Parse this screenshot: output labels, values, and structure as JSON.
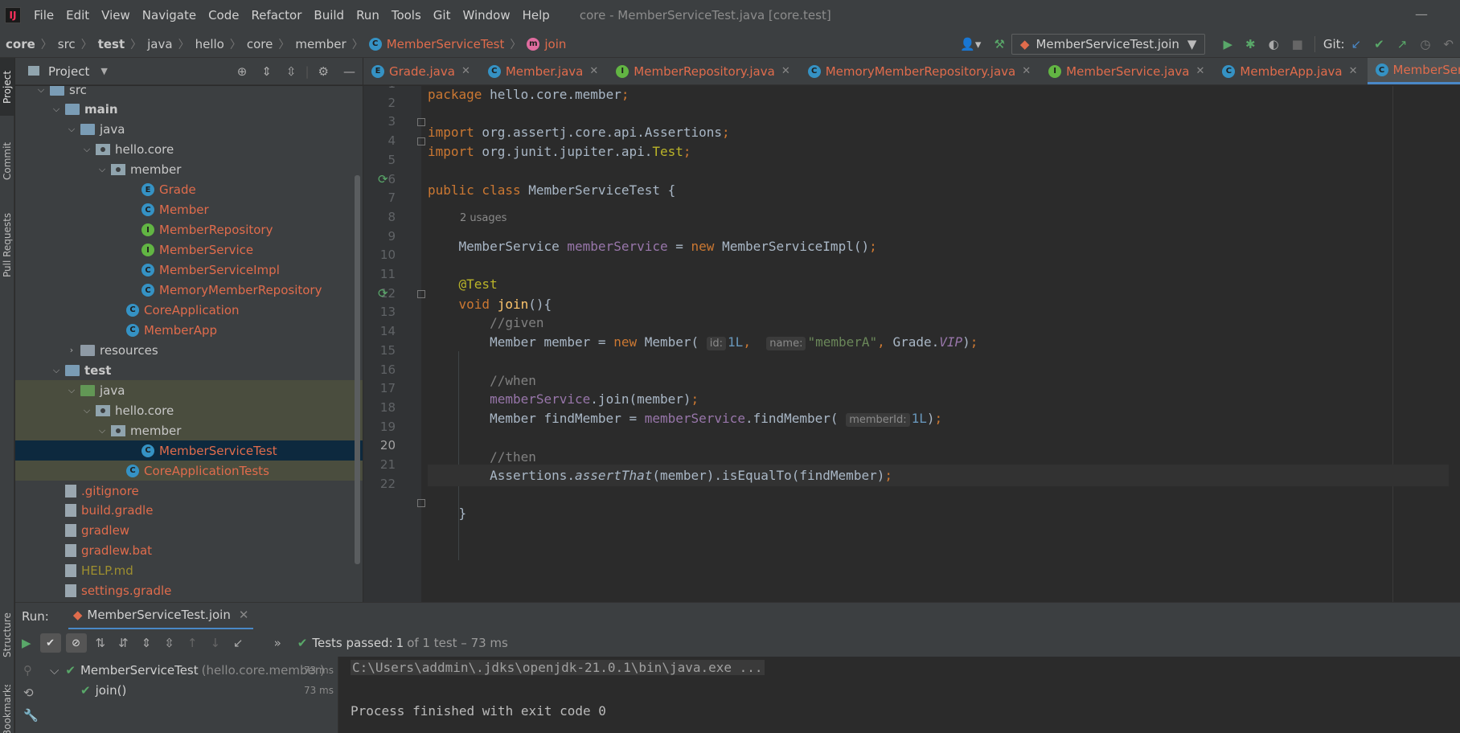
{
  "menubar": {
    "items": [
      "File",
      "Edit",
      "View",
      "Navigate",
      "Code",
      "Refactor",
      "Build",
      "Run",
      "Tools",
      "Git",
      "Window",
      "Help"
    ],
    "window_title": "core - MemberServiceTest.java [core.test]"
  },
  "breadcrumb": {
    "items": [
      "core",
      "src",
      "test",
      "java",
      "hello",
      "core",
      "member",
      "MemberServiceTest",
      "join"
    ]
  },
  "toolbar": {
    "run_config": "MemberServiceTest.join",
    "git_label": "Git:"
  },
  "left_strip": {
    "tabs": [
      "Project",
      "Commit",
      "Pull Requests",
      "Structure",
      "Bookmarks"
    ]
  },
  "project": {
    "title": "Project",
    "tree": [
      {
        "name": "src",
        "level": 1,
        "type": "folder-src",
        "arrow": "open"
      },
      {
        "name": "main",
        "level": 2,
        "type": "folder-src",
        "arrow": "open",
        "bold": true
      },
      {
        "name": "java",
        "level": 3,
        "type": "folder-src",
        "arrow": "open"
      },
      {
        "name": "hello.core",
        "level": 4,
        "type": "package",
        "arrow": "open"
      },
      {
        "name": "member",
        "level": 5,
        "type": "package",
        "arrow": "open"
      },
      {
        "name": "Grade",
        "level": 7,
        "type": "enum",
        "color": "red"
      },
      {
        "name": "Member",
        "level": 7,
        "type": "class",
        "color": "red"
      },
      {
        "name": "MemberRepository",
        "level": 7,
        "type": "interface",
        "color": "red"
      },
      {
        "name": "MemberService",
        "level": 7,
        "type": "interface",
        "color": "red"
      },
      {
        "name": "MemberServiceImpl",
        "level": 7,
        "type": "class",
        "color": "red"
      },
      {
        "name": "MemoryMemberRepository",
        "level": 7,
        "type": "class",
        "color": "red"
      },
      {
        "name": "CoreApplication",
        "level": 6,
        "type": "class-spring",
        "color": "red"
      },
      {
        "name": "MemberApp",
        "level": 6,
        "type": "class-spring",
        "color": "red"
      },
      {
        "name": "resources",
        "level": 3,
        "type": "folder-res",
        "arrow": "closed"
      },
      {
        "name": "test",
        "level": 2,
        "type": "folder-src",
        "arrow": "open",
        "bold": true
      },
      {
        "name": "java",
        "level": 3,
        "type": "folder-test",
        "arrow": "open",
        "highlight": true
      },
      {
        "name": "hello.core",
        "level": 4,
        "type": "package",
        "arrow": "open",
        "highlight": true
      },
      {
        "name": "member",
        "level": 5,
        "type": "package",
        "arrow": "open",
        "highlight": true
      },
      {
        "name": "MemberServiceTest",
        "level": 7,
        "type": "class-spring",
        "color": "red",
        "selected": true
      },
      {
        "name": "CoreApplicationTests",
        "level": 6,
        "type": "class-spring",
        "color": "red",
        "highlight": true
      },
      {
        "name": ".gitignore",
        "level": 2,
        "type": "file",
        "color": "red"
      },
      {
        "name": "build.gradle",
        "level": 2,
        "type": "gradle",
        "color": "red"
      },
      {
        "name": "gradlew",
        "level": 2,
        "type": "file",
        "color": "red"
      },
      {
        "name": "gradlew.bat",
        "level": 2,
        "type": "file",
        "color": "red"
      },
      {
        "name": "HELP.md",
        "level": 2,
        "type": "md",
        "color": "olive"
      },
      {
        "name": "settings.gradle",
        "level": 2,
        "type": "gradle",
        "color": "red"
      }
    ]
  },
  "tabs": [
    {
      "label": "Grade.java",
      "icon": "E"
    },
    {
      "label": "Member.java",
      "icon": "C"
    },
    {
      "label": "MemberRepository.java",
      "icon": "I"
    },
    {
      "label": "MemoryMemberRepository.java",
      "icon": "C"
    },
    {
      "label": "MemberService.java",
      "icon": "I"
    },
    {
      "label": "MemberApp.java",
      "icon": "C"
    },
    {
      "label": "MemberServiceTest.java",
      "icon": "C",
      "active": true
    }
  ],
  "editor": {
    "line_numbers": [
      "1",
      "2",
      "3",
      "4",
      "5",
      "6",
      "7",
      "8",
      "9",
      "10",
      "11",
      "12",
      "13",
      "14",
      "15",
      "16",
      "17",
      "18",
      "19",
      "20",
      "21",
      "22"
    ],
    "current_line": "20",
    "usages_hint": "2 usages",
    "hints": {
      "id": "id:",
      "name": "name:",
      "memberId": "memberId:"
    }
  },
  "run": {
    "label": "Run:",
    "tab_label": "MemberServiceTest.join",
    "status_prefix": "Tests passed:",
    "status_count": "1",
    "status_suffix": "of 1 test – 73 ms",
    "tree": [
      {
        "name": "MemberServiceTest",
        "pkg": "(hello.core.member)",
        "time": "73 ms"
      },
      {
        "name": "join()",
        "time": "73 ms"
      }
    ],
    "console": [
      "C:\\Users\\addmin\\.jdks\\openjdk-21.0.1\\bin\\java.exe ...",
      "Process finished with exit code 0"
    ]
  }
}
